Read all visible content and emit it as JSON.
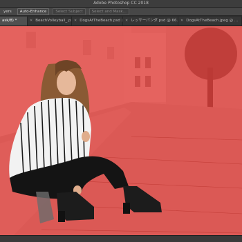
{
  "window": {
    "title": "Adobe Photoshop CC 2018"
  },
  "options_bar": {
    "items": [
      "yers",
      "Auto-Enhance",
      "Select Subject",
      "Select and Mask..."
    ]
  },
  "tabs": [
    {
      "label": "ask/8) *",
      "active": true
    },
    {
      "label": "BeachVolleyball_.psd @ 1...",
      "active": false
    },
    {
      "label": "DogsAtTheBeach.psd @ 5...",
      "active": false
    },
    {
      "label": "レッサーパンダ.psd @ 66.7...",
      "active": false
    },
    {
      "label": "DogsAtTheBeach.jpeg @ ...",
      "active": false
    }
  ],
  "colors": {
    "mask_overlay": "#e8332e",
    "pavement": "#d9473f",
    "sweater_stripe": "#1a1a1a"
  },
  "icons": [
    "close-icon"
  ]
}
